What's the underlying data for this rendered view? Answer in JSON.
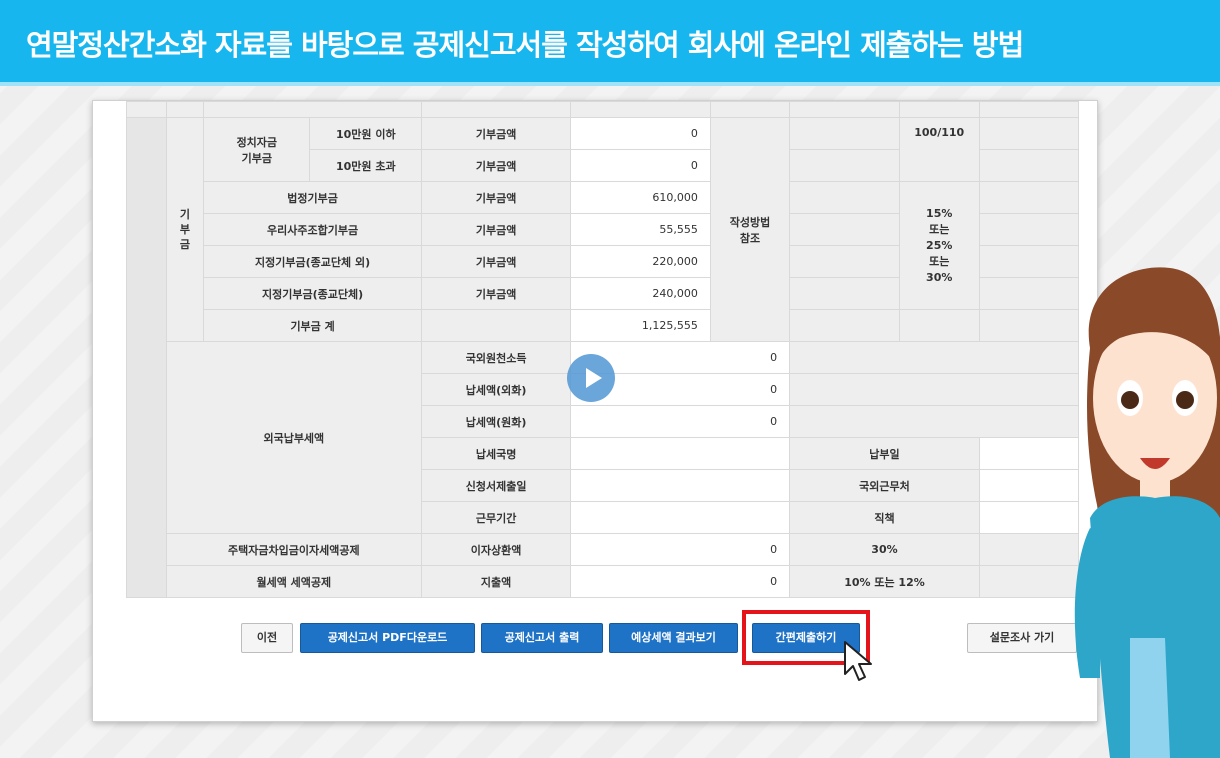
{
  "banner": {
    "title": "연말정산간소화 자료를 바탕으로 공제신고서를 작성하여 회사에 온라인 제출하는 방법"
  },
  "table": {
    "donation_group": "기\n부\n금",
    "political_label": "정치자금\n기부금",
    "rows": [
      {
        "name": "10만원 이하",
        "type": "기부금액",
        "amount": "0"
      },
      {
        "name": "10만원 초과",
        "type": "기부금액",
        "amount": "0"
      },
      {
        "name": "법정기부금",
        "type": "기부금액",
        "amount": "610,000"
      },
      {
        "name": "우리사주조합기부금",
        "type": "기부금액",
        "amount": "55,555"
      },
      {
        "name": "지정기부금(종교단체 외)",
        "type": "기부금액",
        "amount": "220,000"
      },
      {
        "name": "지정기부금(종교단체)",
        "type": "기부금액",
        "amount": "240,000"
      },
      {
        "name": "기부금 계",
        "type": "",
        "amount": "1,125,555"
      }
    ],
    "method_note": "작성방법\n참조",
    "rate_political": "100/110",
    "rate_donation": "15%\n또는\n25%\n또는\n30%",
    "foreign_label": "외국납부세액",
    "foreign_rows": [
      {
        "label": "국외원천소득",
        "value": "0"
      },
      {
        "label": "납세액(외화)",
        "value": "0"
      },
      {
        "label": "납세액(원화)",
        "value": "0"
      },
      {
        "label": "납세국명",
        "value": "",
        "right_label": "납부일"
      },
      {
        "label": "신청서제출일",
        "value": "",
        "right_label": "국외근무처"
      },
      {
        "label": "근무기간",
        "value": "",
        "right_label": "직책"
      }
    ],
    "housing": {
      "label": "주택자금차입금이자세액공제",
      "type": "이자상환액",
      "value": "0",
      "rate": "30%"
    },
    "rent": {
      "label": "월세액 세액공제",
      "type": "지출액",
      "value": "0",
      "rate": "10% 또는 12%"
    }
  },
  "buttons": {
    "prev": "이전",
    "pdf_download": "공제신고서 PDF다운로드",
    "print": "공제신고서 출력",
    "expected_tax": "예상세액 결과보기",
    "simple_submit": "간편제출하기",
    "survey": "설문조사 가기"
  }
}
